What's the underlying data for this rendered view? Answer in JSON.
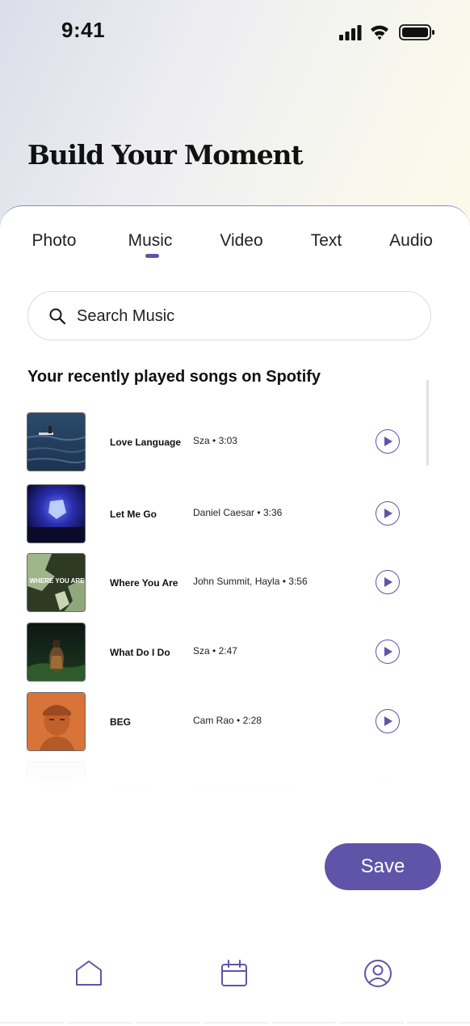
{
  "status_bar": {
    "time": "9:41"
  },
  "page_title": "Build Your Moment",
  "tabs": [
    {
      "label": "Photo",
      "active": false
    },
    {
      "label": "Music",
      "active": true
    },
    {
      "label": "Video",
      "active": false
    },
    {
      "label": "Text",
      "active": false
    },
    {
      "label": "Audio",
      "active": false
    }
  ],
  "search": {
    "placeholder": "Search Music",
    "value": ""
  },
  "section_title": "Your recently played songs on Spotify",
  "songs": [
    {
      "title": "Love Language",
      "artist": "Sza",
      "duration": "3:03",
      "separator": "•"
    },
    {
      "title": "Let Me Go",
      "artist": "Daniel Caesar",
      "duration": "3:36",
      "separator": "•"
    },
    {
      "title": "Where You Are",
      "artist": "John Summit, Hayla",
      "duration": "3:56",
      "separator": "•",
      "cover_text": "WHERE YOU ARE"
    },
    {
      "title": "What Do I Do",
      "artist": "Sza",
      "duration": "2:47",
      "separator": "•"
    },
    {
      "title": "BEG",
      "artist": "Cam Rao",
      "duration": "2:28",
      "separator": "•"
    }
  ],
  "save_label": "Save",
  "nav": [
    {
      "icon": "home-icon"
    },
    {
      "icon": "calendar-icon"
    },
    {
      "icon": "profile-icon"
    }
  ],
  "colors": {
    "accent": "#5f54a8"
  }
}
